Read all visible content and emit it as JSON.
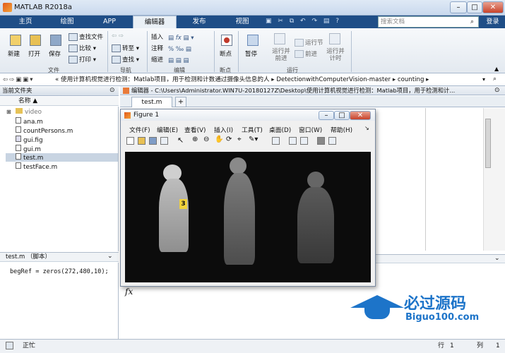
{
  "window": {
    "title": "MATLAB R2018a"
  },
  "tabs": [
    "主页",
    "绘图",
    "APP",
    "编辑器",
    "发布",
    "视图"
  ],
  "search": {
    "placeholder": "搜索文档"
  },
  "login": "登录",
  "ribbon": {
    "file": {
      "new": "新建",
      "open": "打开",
      "save": "保存",
      "find_files": "查找文件",
      "compare": "比较",
      "print": "打印",
      "group": "文件"
    },
    "nav": {
      "goto": "转至",
      "find": "查找",
      "group": "导航"
    },
    "edit": {
      "insert": "插入",
      "comment": "注释",
      "indent": "缩进",
      "group": "编辑"
    },
    "breakpoints": {
      "label": "断点",
      "group": "断点"
    },
    "run": {
      "pause": "暂停",
      "run_advance": "运行并前进",
      "run_section": "运行节",
      "advance": "前进",
      "run_time": "运行并计时",
      "group": "运行"
    }
  },
  "address": {
    "path": "« 使用计算机视觉进行检测：Matlab项目，用于检测和计数通过摄像头信息的人 ▸ DetectionwithComputerVision-master ▸ counting ▸"
  },
  "current_folder": {
    "title": "当前文件夹",
    "column": "名称 ▲",
    "items": [
      "video",
      "ana.m",
      "countPersons.m",
      "gui.fig",
      "gui.m",
      "test.m",
      "testFace.m"
    ]
  },
  "details": {
    "title": "test.m （脚本）",
    "code": "begRef = zeros(272,480,10);"
  },
  "editor": {
    "path": "编辑器 - C:\\Users\\Administrator.WIN7U-20180127Z\\Desktop\\使用计算机视觉进行检测：Matlab项目，用于检测和计...",
    "tab": "test.m",
    "add": "+"
  },
  "figure": {
    "title": "Figure 1",
    "menu": [
      "文件(F)",
      "编辑(E)",
      "查看(V)",
      "插入(I)",
      "工具(T)",
      "桌面(D)",
      "窗口(W)",
      "帮助(H)"
    ],
    "count_label": "3"
  },
  "command": {
    "fx": "fx"
  },
  "watermark": {
    "brand": "必过源码",
    "url": "Biguo100.com"
  },
  "status": {
    "state": "正忙",
    "row_label": "行",
    "row": "1",
    "col_label": "列",
    "col": "1"
  }
}
